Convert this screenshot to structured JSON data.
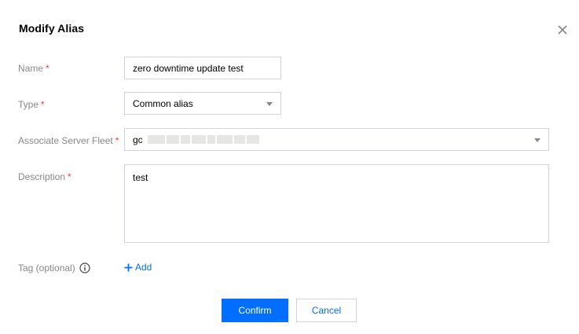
{
  "dialog": {
    "title": "Modify Alias",
    "close_icon": "close-icon"
  },
  "form": {
    "required_marker": "*",
    "name": {
      "label": "Name",
      "value": "zero downtime update test"
    },
    "type": {
      "label": "Type",
      "selected": "Common alias"
    },
    "fleet": {
      "label": "Associate Server Fleet",
      "selected_prefix": "gc"
    },
    "description": {
      "label": "Description",
      "value": "test"
    },
    "tag": {
      "label": "Tag (optional)",
      "info_icon": "info-icon",
      "add_label": "Add",
      "add_icon": "plus-icon"
    }
  },
  "actions": {
    "confirm_label": "Confirm",
    "cancel_label": "Cancel"
  },
  "colors": {
    "primary": "#006eff",
    "required": "#e54545",
    "label": "#888888",
    "border": "#cfd5de"
  }
}
